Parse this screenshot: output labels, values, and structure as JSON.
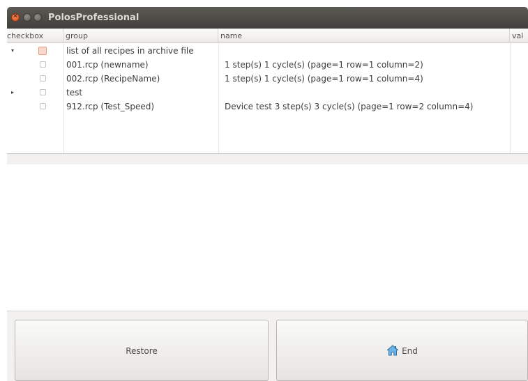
{
  "window": {
    "title": "PolosProfessional"
  },
  "columns": {
    "checkbox": "checkbox",
    "group": "group",
    "name": "name",
    "value": "val"
  },
  "rows": [
    {
      "expander": "▾",
      "group": "list of all recipes in archive file",
      "name": ""
    },
    {
      "expander": "",
      "group": "001.rcp (newname)",
      "name": "1 step(s) 1 cycle(s) (page=1 row=1 column=2)"
    },
    {
      "expander": "",
      "group": "002.rcp (RecipeName)",
      "name": "1 step(s) 1 cycle(s) (page=1 row=1 column=4)"
    },
    {
      "expander": "▸",
      "group": "test",
      "name": ""
    },
    {
      "expander": "",
      "group": "912.rcp (Test_Speed)",
      "name": "Device test 3 step(s) 3 cycle(s) (page=1 row=2 column=4)"
    }
  ],
  "buttons": {
    "restore": "Restore",
    "end": "End"
  },
  "colors": {
    "titlebar": "#403f3b",
    "close_button": "#d94f1c",
    "home_icon": "#3a8fcf"
  },
  "icons": {
    "end_button": "home-icon"
  }
}
